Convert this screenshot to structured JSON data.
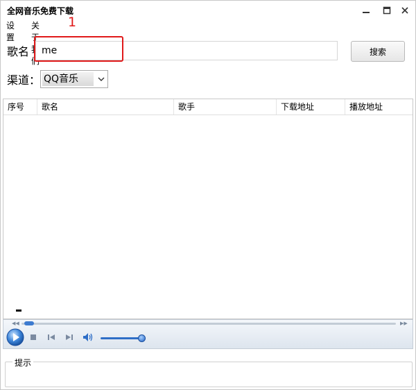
{
  "window": {
    "title": "全网音乐免费下载",
    "controls": [
      "minimize-icon",
      "maximize-icon",
      "close-icon"
    ]
  },
  "menu": {
    "items": [
      "设置",
      "关于我们"
    ]
  },
  "annotation": {
    "step": "1"
  },
  "search": {
    "label": "歌名",
    "value": "me",
    "button_label": "搜索"
  },
  "channel": {
    "label": "渠道：",
    "selected": "QQ音乐"
  },
  "table": {
    "columns": [
      "序号",
      "歌名",
      "歌手",
      "下载地址",
      "播放地址"
    ],
    "rows": []
  },
  "player": {
    "seek_progress": 0.0,
    "volume": 1.0
  },
  "hint": {
    "legend": "提示",
    "text": ""
  },
  "colors": {
    "highlight": "#e0191a",
    "player_accent": "#2e6ec7"
  }
}
